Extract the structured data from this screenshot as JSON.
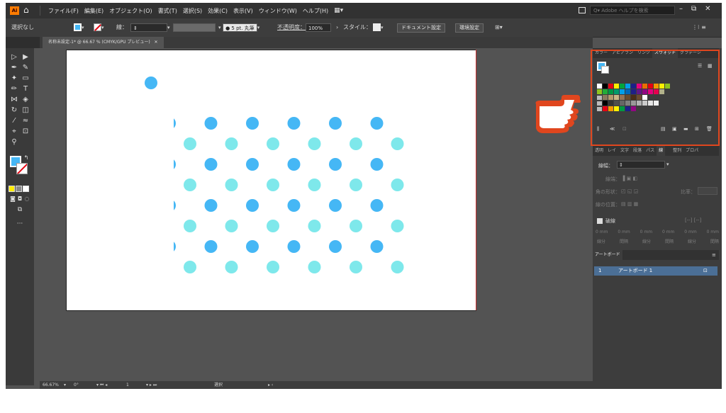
{
  "menubar": {
    "logo": "Ai",
    "items": [
      "ファイル(F)",
      "編集(E)",
      "オブジェクト(O)",
      "書式(T)",
      "選択(S)",
      "効果(C)",
      "表示(V)",
      "ウィンドウ(W)",
      "ヘルプ(H)"
    ],
    "search_placeholder": "Adobe ヘルプを検索",
    "win_minimize": "–",
    "win_restore": "⧉",
    "win_close": "✕"
  },
  "controlbar": {
    "selection": "選択なし",
    "stroke_label": "線：",
    "brush": "5 pt. 丸筆",
    "opacity_label": "不透明度：",
    "opacity_value": "100%",
    "style_label": "スタイル：",
    "doc_settings": "ドキュメント設定",
    "preferences": "環境設定"
  },
  "document": {
    "tab_title": "名称未設定-1* @ 66.67 % (CMYK/GPU プレビュー)",
    "tab_close": "✕"
  },
  "canvas": {
    "colors": {
      "blue": "#45b7f5",
      "cyan": "#7ee8eb",
      "bleed": "#c83030"
    },
    "dots": {
      "single": {
        "x": 0,
        "y": 0
      },
      "blue_rows": 4,
      "cyan_rows": 4,
      "blue_cols": 5,
      "cyan_cols": 6
    }
  },
  "statusbar": {
    "zoom": "66.67%",
    "rotation": "0°",
    "artboard_number": "1",
    "mode": "選択"
  },
  "panel": {
    "tabs": [
      "カラー",
      "アピアラン",
      "リンク",
      "スウォッチ",
      "グラデーシ"
    ],
    "active_tab": "スウォッチ",
    "lower_tabs": [
      "透明",
      "レイ",
      "文字",
      "段落",
      "パス",
      "線"
    ],
    "lower_right_tabs": [
      "整列",
      "プロパ"
    ],
    "stroke_width_label": "線幅：",
    "tip_label": "線端：",
    "corner_label": "角の形状：",
    "ratio_label": "比率：",
    "align_label": "線の位置：",
    "dash_label": "破線",
    "dash_values": [
      "0 mm",
      "0 mm",
      "0 mm",
      "0 mm",
      "0 mm",
      "0 mm"
    ],
    "dash_labels": [
      "線分",
      "間隔",
      "線分",
      "間隔",
      "線分",
      "間隔"
    ],
    "artboards_header": "アートボード",
    "artboard_index": "1",
    "artboard_name": "アートボード 1"
  },
  "swatches": {
    "row1": [
      "#ffffff",
      "#000000",
      "#e30613",
      "#ffed00",
      "#00a53c",
      "#00a0e9",
      "#1d2088",
      "#e5007f",
      "#ec6d00",
      "#e60012",
      "#f39800",
      "#fff100",
      "#8fc31f"
    ],
    "row2": [
      "#8fc31f",
      "#22ac38",
      "#009944",
      "#009b6b",
      "#00a0e9",
      "#0068b7",
      "#1d2088",
      "#601986",
      "#920783",
      "#e4007f",
      "#e5004f",
      "#b2b28a"
    ],
    "row3": [
      "#897a5d",
      "#b49a6c",
      "#c9b687",
      "#957354",
      "#6a4b2b",
      "#4a2e18",
      "#6c4a2f",
      "#ffffff"
    ],
    "row4": [
      "#000000",
      "#333333",
      "#4d4d4d",
      "#666666",
      "#808080",
      "#999999",
      "#b3b3b3",
      "#cccccc",
      "#e6e6e6",
      "#f2f2f2"
    ],
    "row5": [
      "#e60012",
      "#f39800",
      "#fff100",
      "#009944",
      "#1d2088",
      "#920783"
    ]
  }
}
